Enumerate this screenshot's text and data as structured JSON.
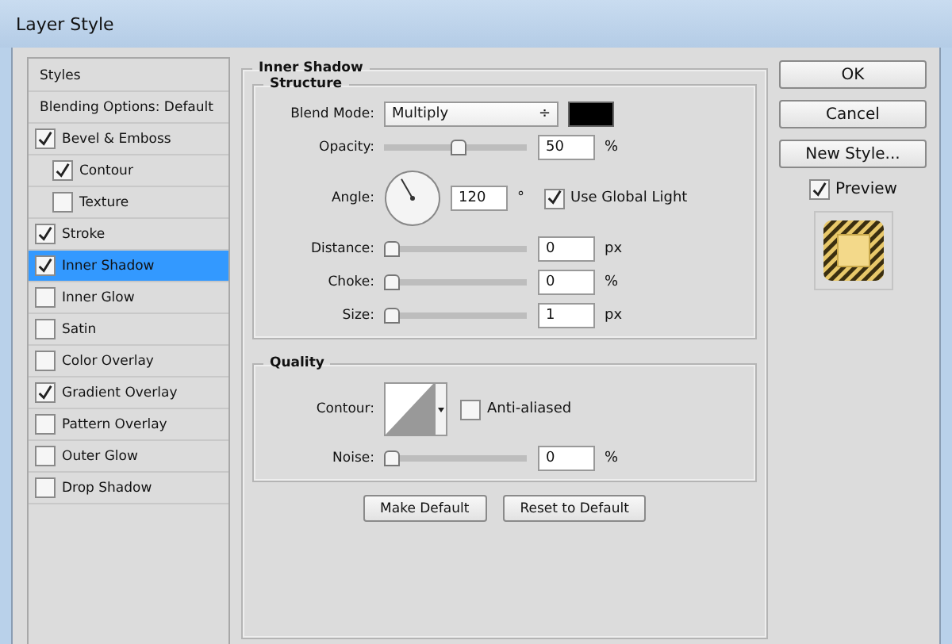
{
  "window": {
    "title": "Layer Style"
  },
  "styles_list": [
    {
      "kind": "header",
      "label": "Styles",
      "selected": false
    },
    {
      "kind": "header",
      "label": "Blending Options: Default",
      "selected": false
    },
    {
      "kind": "option",
      "label": "Bevel & Emboss",
      "checked": true,
      "selected": false,
      "children": [
        {
          "kind": "option",
          "label": "Contour",
          "checked": true,
          "selected": false
        },
        {
          "kind": "option",
          "label": "Texture",
          "checked": false,
          "selected": false
        }
      ]
    },
    {
      "kind": "option",
      "label": "Stroke",
      "checked": true,
      "selected": false
    },
    {
      "kind": "option",
      "label": "Inner Shadow",
      "checked": true,
      "selected": true
    },
    {
      "kind": "option",
      "label": "Inner Glow",
      "checked": false,
      "selected": false
    },
    {
      "kind": "option",
      "label": "Satin",
      "checked": false,
      "selected": false
    },
    {
      "kind": "option",
      "label": "Color Overlay",
      "checked": false,
      "selected": false
    },
    {
      "kind": "option",
      "label": "Gradient Overlay",
      "checked": true,
      "selected": false
    },
    {
      "kind": "option",
      "label": "Pattern Overlay",
      "checked": false,
      "selected": false
    },
    {
      "kind": "option",
      "label": "Outer Glow",
      "checked": false,
      "selected": false
    },
    {
      "kind": "option",
      "label": "Drop Shadow",
      "checked": false,
      "selected": false
    }
  ],
  "panel": {
    "title": "Inner Shadow",
    "structure": {
      "title": "Structure",
      "blend_mode": {
        "label": "Blend Mode:",
        "value": "Multiply",
        "arrow": "÷",
        "color": "#000000"
      },
      "opacity": {
        "label": "Opacity:",
        "level": 0.53,
        "value": "50",
        "unit": "%"
      },
      "angle": {
        "label": "Angle:",
        "value": "120",
        "unit": "°",
        "use_global_light": {
          "label": "Use Global Light",
          "checked": true
        }
      },
      "sliders": [
        {
          "label": "Distance:",
          "level": 0,
          "value": "0",
          "unit": "px"
        },
        {
          "label": "Choke:",
          "level": 0,
          "value": "0",
          "unit": "%"
        },
        {
          "label": "Size:",
          "level": 0,
          "value": "1",
          "unit": "px"
        }
      ]
    },
    "quality": {
      "title": "Quality",
      "contour": {
        "label": "Contour:"
      },
      "anti_aliased": {
        "label": "Anti-aliased",
        "checked": false
      },
      "noise": {
        "label": "Noise:",
        "level": 0,
        "value": "0",
        "unit": "%"
      }
    },
    "buttons": [
      "Make Default",
      "Reset to Default"
    ]
  },
  "side_buttons": [
    "OK",
    "Cancel",
    "New Style..."
  ],
  "preview": {
    "label": "Preview",
    "checked": true
  }
}
